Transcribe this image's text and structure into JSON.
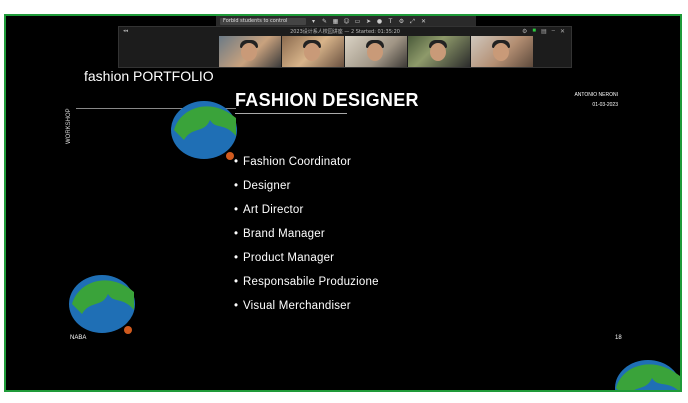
{
  "toolbar": {
    "share_select": "Forbid students to control"
  },
  "meeting": {
    "title": "2023设计系人校园讲座 — 2    Started: 01:35:20"
  },
  "slide": {
    "workshop_label": "WORKSHOP",
    "portfolio_title": "fashion PORTFOLIO",
    "heading": "FASHION DESIGNER",
    "author": "ANTONIO NERONI",
    "date": "01-03-2023",
    "list": [
      "Fashion Coordinator",
      "Designer",
      "Art Director",
      "Brand Manager",
      "Product Manager",
      "Responsabile Produzione",
      "Visual Merchandiser"
    ],
    "bullet": "•",
    "footer_left": "NABA",
    "page_number": "18"
  },
  "colors": {
    "frame_border": "#1f9b3a",
    "slide_bg": "#000000",
    "logo_blue": "#1f6fb5",
    "logo_green": "#3aa33a",
    "logo_orange": "#d05a1e"
  },
  "icons": [
    "close-icon",
    "pen-icon",
    "grid-icon",
    "people-icon",
    "screen-icon",
    "pointer-icon",
    "record-icon",
    "text-icon",
    "settings-icon",
    "more-icon"
  ]
}
